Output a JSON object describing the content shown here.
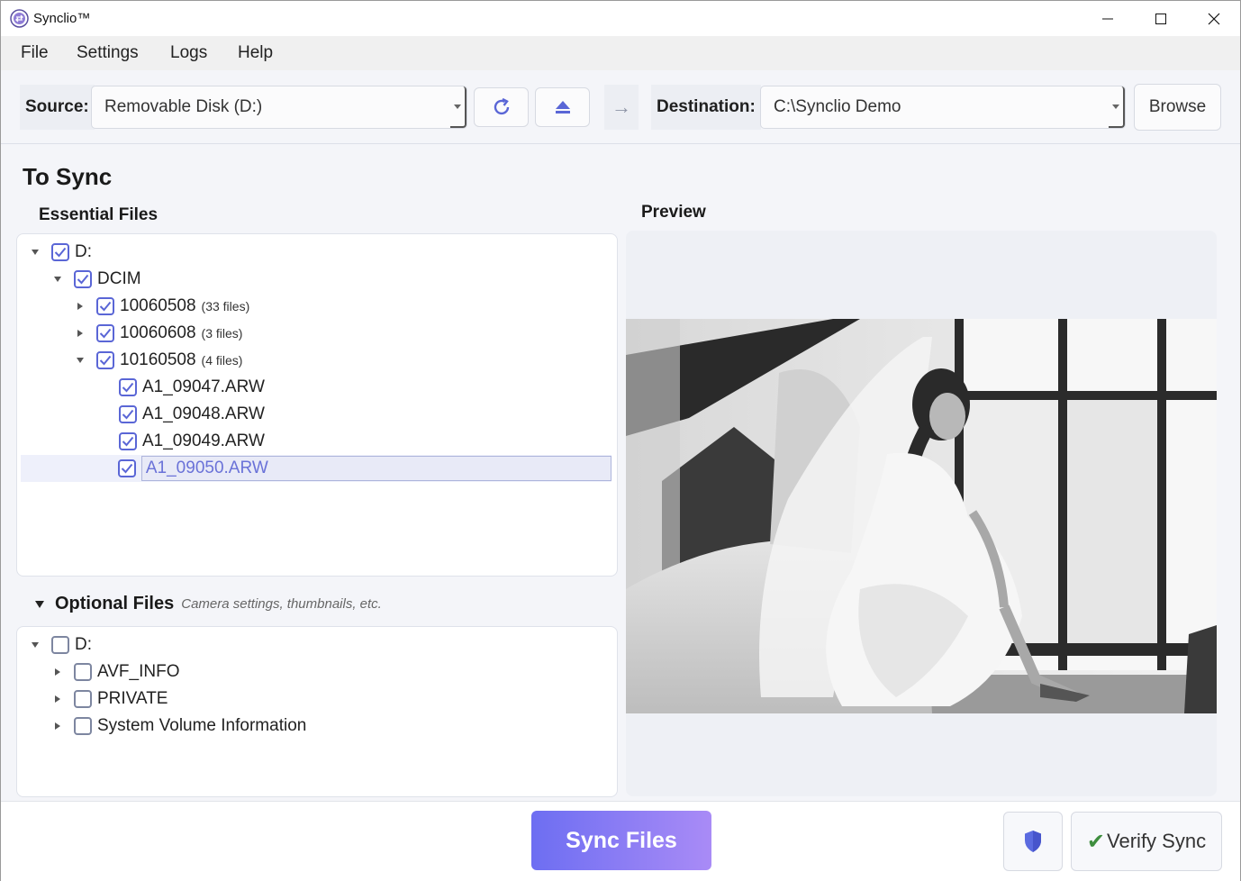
{
  "app": {
    "title": "Synclio™"
  },
  "menu": [
    "File",
    "Settings",
    "Logs",
    "Help"
  ],
  "toolbar": {
    "source_label": "Source:",
    "source_value": "Removable Disk (D:)",
    "destination_label": "Destination:",
    "destination_value": "C:\\Synclio Demo",
    "browse_label": "Browse",
    "arrow": "→"
  },
  "to_sync": {
    "title": "To Sync",
    "essential_title": "Essential Files",
    "tree": [
      {
        "label": "D:",
        "count": "",
        "checked": true,
        "expander": "down",
        "level": 0,
        "selected": false
      },
      {
        "label": "DCIM",
        "count": "",
        "checked": true,
        "expander": "down",
        "level": 1,
        "selected": false
      },
      {
        "label": "10060508",
        "count": "(33 files)",
        "checked": true,
        "expander": "right",
        "level": 2,
        "selected": false
      },
      {
        "label": "10060608",
        "count": "(3 files)",
        "checked": true,
        "expander": "right",
        "level": 2,
        "selected": false
      },
      {
        "label": "10160508",
        "count": "(4 files)",
        "checked": true,
        "expander": "down",
        "level": 2,
        "selected": false
      },
      {
        "label": "A1_09047.ARW",
        "count": "",
        "checked": true,
        "expander": "none",
        "level": 3,
        "selected": false
      },
      {
        "label": "A1_09048.ARW",
        "count": "",
        "checked": true,
        "expander": "none",
        "level": 3,
        "selected": false
      },
      {
        "label": "A1_09049.ARW",
        "count": "",
        "checked": true,
        "expander": "none",
        "level": 3,
        "selected": false
      },
      {
        "label": "A1_09050.ARW",
        "count": "",
        "checked": true,
        "expander": "none",
        "level": 3,
        "selected": true
      }
    ]
  },
  "optional": {
    "title": "Optional Files",
    "hint": "Camera settings, thumbnails, etc.",
    "tree": [
      {
        "label": "D:",
        "checked": false,
        "expander": "down",
        "level": 0
      },
      {
        "label": "AVF_INFO",
        "checked": false,
        "expander": "right",
        "level": 1
      },
      {
        "label": "PRIVATE",
        "checked": false,
        "expander": "right",
        "level": 1
      },
      {
        "label": "System Volume Information",
        "checked": false,
        "expander": "right",
        "level": 1
      }
    ]
  },
  "preview": {
    "title": "Preview"
  },
  "footer": {
    "sync_label": "Sync Files",
    "verify_label": "Verify Sync",
    "verify_check": "✔"
  },
  "colors": {
    "accent": "#6d6ef2",
    "accent_end": "#a98bf6",
    "checkbox": "#5a66d6",
    "shield": "#5b6be0"
  }
}
